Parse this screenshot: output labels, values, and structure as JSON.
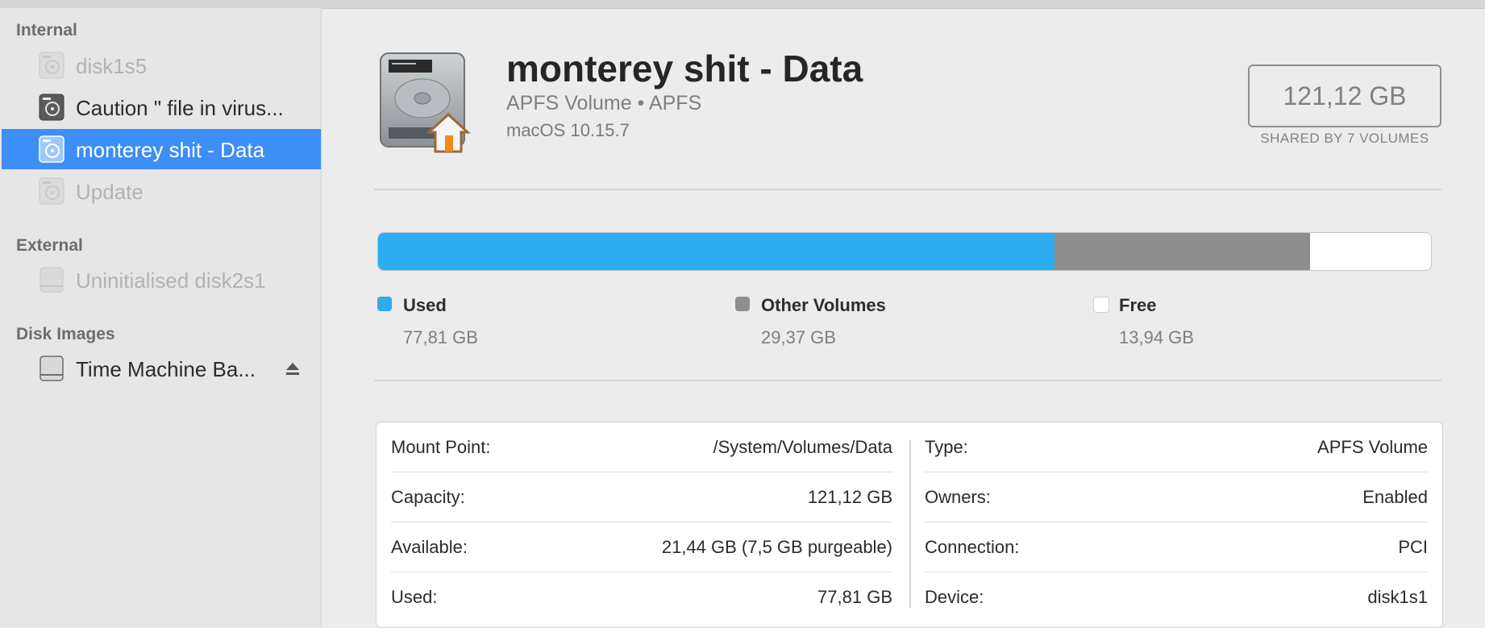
{
  "sidebar": {
    "sections": [
      {
        "label": "Internal"
      },
      {
        "label": "External"
      },
      {
        "label": "Disk Images"
      }
    ],
    "items": [
      {
        "label": "disk1s5",
        "icon": "internal-disk-icon",
        "state": "dimmed"
      },
      {
        "label": "Caution \" file in virus...",
        "icon": "internal-disk-icon",
        "state": "normal"
      },
      {
        "label": "monterey shit - Data",
        "icon": "internal-disk-icon",
        "state": "selected"
      },
      {
        "label": "Update",
        "icon": "internal-disk-icon",
        "state": "dimmed"
      },
      {
        "label": "Uninitialised disk2s1",
        "icon": "external-disk-icon",
        "state": "dimmed"
      },
      {
        "label": "Time Machine Ba...",
        "icon": "disk-image-icon",
        "state": "normal",
        "eject": "eject-icon"
      }
    ]
  },
  "volume": {
    "name": "monterey shit - Data",
    "subtitle": "APFS Volume • APFS",
    "os": "macOS 10.15.7",
    "capacity": "121,12 GB",
    "shared": "SHARED BY 7 VOLUMES",
    "icon": "home-drive-icon"
  },
  "usage": {
    "total_gb": 121.12,
    "segments": [
      {
        "name": "Used",
        "value": "77,81 GB",
        "gb": 77.81,
        "color": "#2eacf2"
      },
      {
        "name": "Other Volumes",
        "value": "29,37 GB",
        "gb": 29.37,
        "color": "#8e8e8e"
      },
      {
        "name": "Free",
        "value": "13,94 GB",
        "gb": 13.94,
        "color": "#ffffff"
      }
    ]
  },
  "info": {
    "left": [
      {
        "key": "Mount Point:",
        "value": "/System/Volumes/Data"
      },
      {
        "key": "Capacity:",
        "value": "121,12 GB"
      },
      {
        "key": "Available:",
        "value": "21,44 GB (7,5 GB purgeable)"
      },
      {
        "key": "Used:",
        "value": "77,81 GB"
      }
    ],
    "right": [
      {
        "key": "Type:",
        "value": "APFS Volume"
      },
      {
        "key": "Owners:",
        "value": "Enabled"
      },
      {
        "key": "Connection:",
        "value": "PCI"
      },
      {
        "key": "Device:",
        "value": "disk1s1"
      }
    ]
  }
}
